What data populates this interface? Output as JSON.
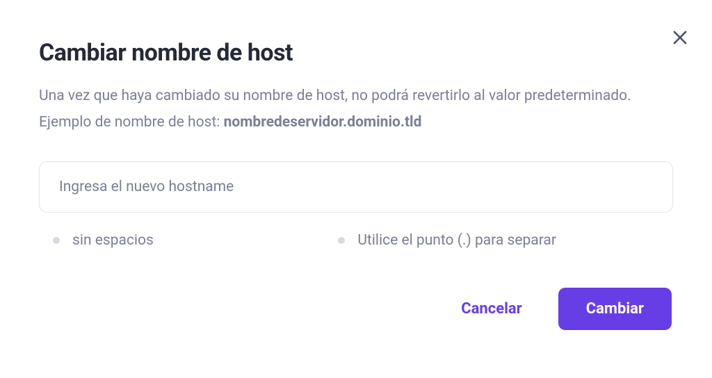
{
  "dialog": {
    "title": "Cambiar nombre de host",
    "description_text": "Una vez que haya cambiado su nombre de host, no podrá revertirlo al valor predeterminado. Ejemplo de nombre de host: ",
    "description_example": "nombredeservidor.dominio.tld",
    "input": {
      "placeholder": "Ingresa el nuevo hostname",
      "value": ""
    },
    "hints": [
      {
        "text": "sin espacios"
      },
      {
        "text": "Utilice el punto (.) para separar"
      }
    ],
    "actions": {
      "cancel": "Cancelar",
      "confirm": "Cambiar"
    }
  },
  "colors": {
    "accent": "#673de6",
    "text_primary": "#262a37",
    "text_secondary": "#7a7f94",
    "border": "#e2e3ea",
    "bullet": "#d8dae3"
  }
}
